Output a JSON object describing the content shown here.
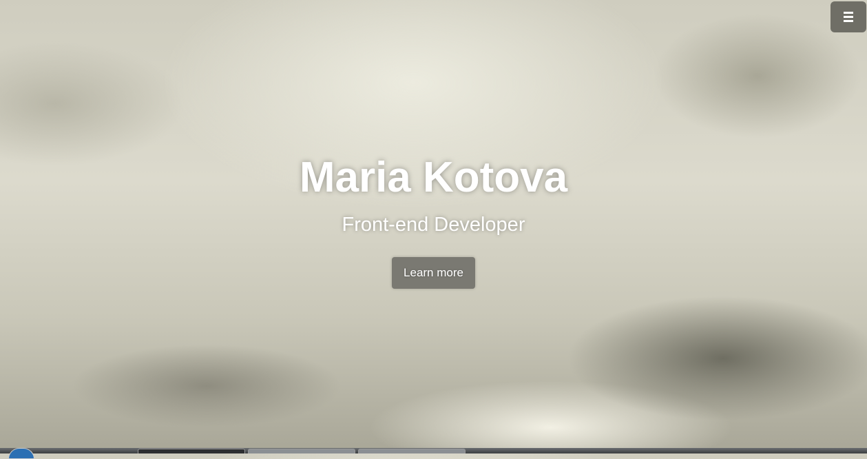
{
  "hero": {
    "name": "Maria Kotova",
    "role": "Front-end Developer",
    "cta_label": "Learn more"
  },
  "menu": {
    "icon": "hamburger-menu-icon"
  },
  "colors": {
    "button_bg": "#7a7972",
    "menu_bg": "#6f6e66",
    "text": "#ffffff"
  }
}
